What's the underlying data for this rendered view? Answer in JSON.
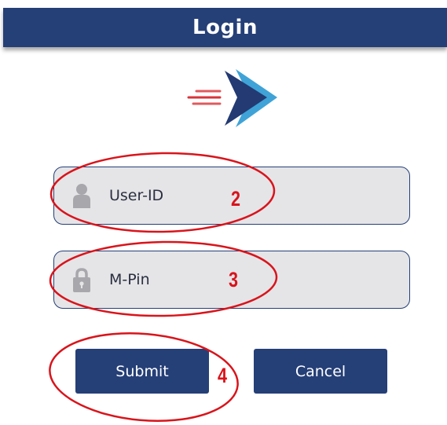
{
  "header": {
    "title": "Login"
  },
  "login_form": {
    "userid_placeholder": "User-ID",
    "mpin_placeholder": "M-Pin",
    "submit_label": "Submit",
    "cancel_label": "Cancel"
  },
  "annotations": [
    {
      "number": "2",
      "target": "userid-field"
    },
    {
      "number": "3",
      "target": "mpin-field"
    },
    {
      "number": "4",
      "target": "submit-button"
    }
  ],
  "icons": {
    "logo": "arrow-logo",
    "userid": "user-icon",
    "mpin": "lock-icon"
  },
  "colors": {
    "primary": "#253f77",
    "field_background": "#e5e5e8",
    "annotation": "#d9141b",
    "logo_accent_light": "#3fa3d8",
    "logo_accent_red": "#d8343a"
  }
}
